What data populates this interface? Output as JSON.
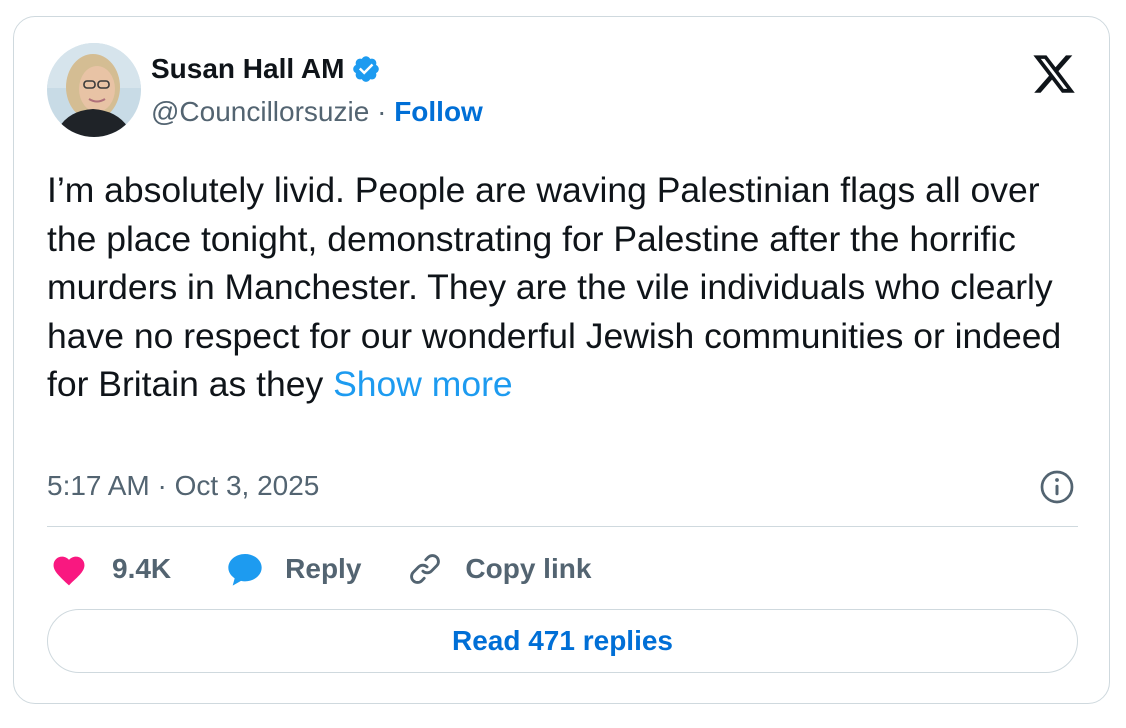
{
  "author": {
    "display_name": "Susan Hall AM",
    "handle": "@Councillorsuzie",
    "separator": " · ",
    "follow_label": "Follow",
    "verified": true
  },
  "tweet": {
    "text": "I’m absolutely livid. People are waving Palestinian flags all over the place tonight, demonstrating for Palestine after the horrific murders in Manchester. They are the vile individuals who clearly have no respect for our wonderful Jewish communities or indeed for Britain as they ",
    "show_more_label": "Show more",
    "timestamp": "5:17 AM · Oct 3, 2025"
  },
  "actions": {
    "likes_count": "9.4K",
    "reply_label": "Reply",
    "copy_link_label": "Copy link"
  },
  "read_replies_label": "Read 471 replies",
  "colors": {
    "link_blue": "#006fd6",
    "show_more_blue": "#1d9bf0",
    "like_pink": "#f91880",
    "reply_blue": "#1d9bf0",
    "secondary_text": "#536471",
    "border": "#cfd9de"
  },
  "icons": {
    "verified": "verified-badge-icon",
    "brand": "x-logo-icon",
    "info": "info-icon",
    "like": "heart-icon",
    "reply": "speech-bubble-icon",
    "copy": "link-icon"
  }
}
